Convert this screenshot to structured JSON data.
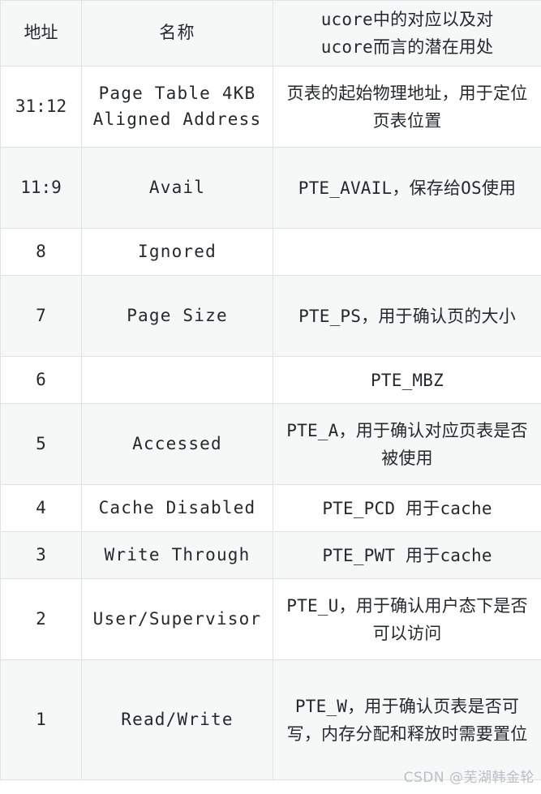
{
  "table": {
    "columns": [
      "地址",
      "名称",
      "ucore中的对应以及对ucore而言的潜在用处"
    ],
    "header": {
      "address": "地址",
      "name": "名称",
      "usage_line1": "ucore中的对应以及对",
      "usage_line2": "ucore而言的潜在用处"
    },
    "rows": [
      {
        "address": "31:12",
        "name": "Page Table 4KB Aligned Address",
        "usage": "页表的起始物理地址，用于定位页表位置"
      },
      {
        "address": "11:9",
        "name": "Avail",
        "usage": "PTE_AVAIL，保存给OS使用"
      },
      {
        "address": "8",
        "name": "Ignored",
        "usage": ""
      },
      {
        "address": "7",
        "name": "Page Size",
        "usage": "PTE_PS，用于确认页的大小"
      },
      {
        "address": "6",
        "name": "",
        "usage": "PTE_MBZ"
      },
      {
        "address": "5",
        "name": "Accessed",
        "usage": "PTE_A，用于确认对应页表是否被使用"
      },
      {
        "address": "4",
        "name": "Cache Disabled",
        "usage": "PTE_PCD 用于cache"
      },
      {
        "address": "3",
        "name": "Write Through",
        "usage": "PTE_PWT 用于cache"
      },
      {
        "address": "2",
        "name": "User/Supervisor",
        "usage": "PTE_U，用于确认用户态下是否可以访问"
      },
      {
        "address": "1",
        "name": "Read/Write",
        "usage": "PTE_W，用于确认页表是否可写，内存分配和释放时需要置位"
      }
    ]
  },
  "watermark": {
    "text": "CSDN @芜湖韩金轮"
  },
  "colors": {
    "border": "#dfe2e5",
    "shade_row": "#f6f8f8",
    "plain_row": "#ffffff",
    "text": "#24292e",
    "watermark": "#b9bfc6"
  }
}
